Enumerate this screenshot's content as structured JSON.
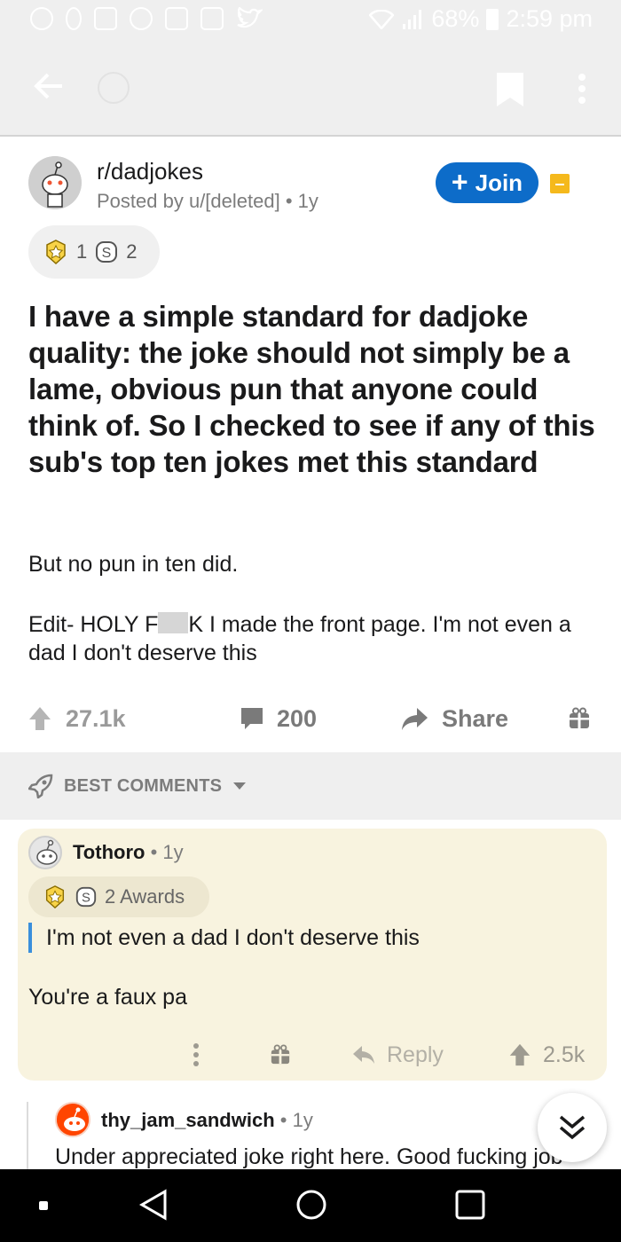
{
  "status_bar": {
    "battery": "68%",
    "time": "2:59 pm"
  },
  "post": {
    "subreddit": "r/dadjokes",
    "posted_by": "Posted by u/[deleted]",
    "age": "1y",
    "join_label": "Join",
    "awards": {
      "gold_count": "1",
      "silver_count": "2"
    },
    "title": "I have a simple standard for dadjoke quality: the joke should not simply be a lame, obvious pun that anyone could think of. So I checked to see if any of this sub's top ten jokes met this standard",
    "body_line1": "But no pun in ten did.",
    "edit_prefix": "Edit- HOLY F",
    "edit_suffix": "K I made the front page. I'm not even a dad I don't deserve this",
    "upvotes": "27.1k",
    "comments": "200",
    "share_label": "Share"
  },
  "comments_section": {
    "sort_label": "BEST COMMENTS"
  },
  "comment": {
    "author": "Tothoro",
    "age": "1y",
    "awards_label": "2 Awards",
    "quote": "I'm not even a dad I don't deserve this",
    "text": "You're a faux pa",
    "reply_label": "Reply",
    "score": "2.5k"
  },
  "reply": {
    "author": "thy_jam_sandwich",
    "age": "1y",
    "text": "Under appreciated joke right here. Good fucking job"
  },
  "colors": {
    "join_blue": "#0d6cc9",
    "comment_bg": "#f8f3df",
    "quote_bar": "#3a8fdc",
    "archive": "#f5b91c"
  }
}
